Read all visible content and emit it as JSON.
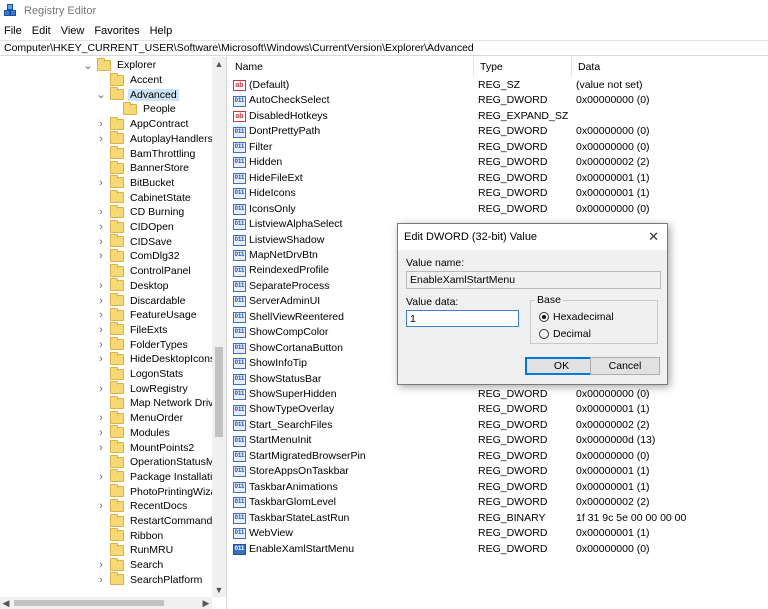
{
  "window": {
    "title": "Registry Editor"
  },
  "menu": [
    "File",
    "Edit",
    "View",
    "Favorites",
    "Help"
  ],
  "address": "Computer\\HKEY_CURRENT_USER\\Software\\Microsoft\\Windows\\CurrentVersion\\Explorer\\Advanced",
  "tree": [
    {
      "label": "Explorer",
      "level": 0,
      "expander": "expanded"
    },
    {
      "label": "Accent",
      "level": 1,
      "expander": "none"
    },
    {
      "label": "Advanced",
      "level": 1,
      "expander": "expanded",
      "selected": true
    },
    {
      "label": "People",
      "level": 2,
      "expander": "none"
    },
    {
      "label": "AppContract",
      "level": 1,
      "expander": "collapsed"
    },
    {
      "label": "AutoplayHandlers",
      "level": 1,
      "expander": "collapsed"
    },
    {
      "label": "BamThrottling",
      "level": 1,
      "expander": "none"
    },
    {
      "label": "BannerStore",
      "level": 1,
      "expander": "none"
    },
    {
      "label": "BitBucket",
      "level": 1,
      "expander": "collapsed"
    },
    {
      "label": "CabinetState",
      "level": 1,
      "expander": "none"
    },
    {
      "label": "CD Burning",
      "level": 1,
      "expander": "collapsed"
    },
    {
      "label": "CIDOpen",
      "level": 1,
      "expander": "collapsed"
    },
    {
      "label": "CIDSave",
      "level": 1,
      "expander": "collapsed"
    },
    {
      "label": "ComDlg32",
      "level": 1,
      "expander": "collapsed"
    },
    {
      "label": "ControlPanel",
      "level": 1,
      "expander": "none"
    },
    {
      "label": "Desktop",
      "level": 1,
      "expander": "collapsed"
    },
    {
      "label": "Discardable",
      "level": 1,
      "expander": "collapsed"
    },
    {
      "label": "FeatureUsage",
      "level": 1,
      "expander": "collapsed"
    },
    {
      "label": "FileExts",
      "level": 1,
      "expander": "collapsed"
    },
    {
      "label": "FolderTypes",
      "level": 1,
      "expander": "collapsed"
    },
    {
      "label": "HideDesktopIcons",
      "level": 1,
      "expander": "collapsed"
    },
    {
      "label": "LogonStats",
      "level": 1,
      "expander": "none"
    },
    {
      "label": "LowRegistry",
      "level": 1,
      "expander": "collapsed"
    },
    {
      "label": "Map Network Drive",
      "level": 1,
      "expander": "none"
    },
    {
      "label": "MenuOrder",
      "level": 1,
      "expander": "collapsed"
    },
    {
      "label": "Modules",
      "level": 1,
      "expander": "collapsed"
    },
    {
      "label": "MountPoints2",
      "level": 1,
      "expander": "collapsed"
    },
    {
      "label": "OperationStatusMar",
      "level": 1,
      "expander": "none"
    },
    {
      "label": "Package Installation",
      "level": 1,
      "expander": "collapsed"
    },
    {
      "label": "PhotoPrintingWizarc",
      "level": 1,
      "expander": "none"
    },
    {
      "label": "RecentDocs",
      "level": 1,
      "expander": "collapsed"
    },
    {
      "label": "RestartCommands",
      "level": 1,
      "expander": "none"
    },
    {
      "label": "Ribbon",
      "level": 1,
      "expander": "none"
    },
    {
      "label": "RunMRU",
      "level": 1,
      "expander": "none"
    },
    {
      "label": "Search",
      "level": 1,
      "expander": "collapsed"
    },
    {
      "label": "SearchPlatform",
      "level": 1,
      "expander": "collapsed"
    }
  ],
  "columns": {
    "name": "Name",
    "type": "Type",
    "data": "Data"
  },
  "values": [
    {
      "name": "(Default)",
      "type": "REG_SZ",
      "data": "(value not set)",
      "icon": "string-value-icon"
    },
    {
      "name": "AutoCheckSelect",
      "type": "REG_DWORD",
      "data": "0x00000000 (0)",
      "icon": "binary-value-icon"
    },
    {
      "name": "DisabledHotkeys",
      "type": "REG_EXPAND_SZ",
      "data": "",
      "icon": "string-value-icon"
    },
    {
      "name": "DontPrettyPath",
      "type": "REG_DWORD",
      "data": "0x00000000 (0)",
      "icon": "binary-value-icon"
    },
    {
      "name": "Filter",
      "type": "REG_DWORD",
      "data": "0x00000000 (0)",
      "icon": "binary-value-icon"
    },
    {
      "name": "Hidden",
      "type": "REG_DWORD",
      "data": "0x00000002 (2)",
      "icon": "binary-value-icon"
    },
    {
      "name": "HideFileExt",
      "type": "REG_DWORD",
      "data": "0x00000001 (1)",
      "icon": "binary-value-icon"
    },
    {
      "name": "HideIcons",
      "type": "REG_DWORD",
      "data": "0x00000001 (1)",
      "icon": "binary-value-icon"
    },
    {
      "name": "IconsOnly",
      "type": "REG_DWORD",
      "data": "0x00000000 (0)",
      "icon": "binary-value-icon"
    },
    {
      "name": "ListviewAlphaSelect",
      "type": "",
      "data": "",
      "icon": "binary-value-icon"
    },
    {
      "name": "ListviewShadow",
      "type": "",
      "data": "",
      "icon": "binary-value-icon"
    },
    {
      "name": "MapNetDrvBtn",
      "type": "",
      "data": "",
      "icon": "binary-value-icon"
    },
    {
      "name": "ReindexedProfile",
      "type": "",
      "data": "",
      "icon": "binary-value-icon"
    },
    {
      "name": "SeparateProcess",
      "type": "",
      "data": "",
      "icon": "binary-value-icon"
    },
    {
      "name": "ServerAdminUI",
      "type": "",
      "data": "",
      "icon": "binary-value-icon"
    },
    {
      "name": "ShellViewReentered",
      "type": "",
      "data": "",
      "icon": "binary-value-icon"
    },
    {
      "name": "ShowCompColor",
      "type": "",
      "data": "",
      "icon": "binary-value-icon"
    },
    {
      "name": "ShowCortanaButton",
      "type": "",
      "data": "",
      "icon": "binary-value-icon"
    },
    {
      "name": "ShowInfoTip",
      "type": "",
      "data": "",
      "icon": "binary-value-icon"
    },
    {
      "name": "ShowStatusBar",
      "type": "",
      "data": "",
      "icon": "binary-value-icon"
    },
    {
      "name": "ShowSuperHidden",
      "type": "REG_DWORD",
      "data": "0x00000000 (0)",
      "icon": "binary-value-icon"
    },
    {
      "name": "ShowTypeOverlay",
      "type": "REG_DWORD",
      "data": "0x00000001 (1)",
      "icon": "binary-value-icon"
    },
    {
      "name": "Start_SearchFiles",
      "type": "REG_DWORD",
      "data": "0x00000002 (2)",
      "icon": "binary-value-icon"
    },
    {
      "name": "StartMenuInit",
      "type": "REG_DWORD",
      "data": "0x0000000d (13)",
      "icon": "binary-value-icon"
    },
    {
      "name": "StartMigratedBrowserPin",
      "type": "REG_DWORD",
      "data": "0x00000000 (0)",
      "icon": "binary-value-icon"
    },
    {
      "name": "StoreAppsOnTaskbar",
      "type": "REG_DWORD",
      "data": "0x00000001 (1)",
      "icon": "binary-value-icon"
    },
    {
      "name": "TaskbarAnimations",
      "type": "REG_DWORD",
      "data": "0x00000001 (1)",
      "icon": "binary-value-icon"
    },
    {
      "name": "TaskbarGlomLevel",
      "type": "REG_DWORD",
      "data": "0x00000002 (2)",
      "icon": "binary-value-icon"
    },
    {
      "name": "TaskbarStateLastRun",
      "type": "REG_BINARY",
      "data": "1f 31 9c 5e 00 00 00 00",
      "icon": "binary-value-icon"
    },
    {
      "name": "WebView",
      "type": "REG_DWORD",
      "data": "0x00000001 (1)",
      "icon": "binary-value-icon"
    },
    {
      "name": "EnableXamlStartMenu",
      "type": "REG_DWORD",
      "data": "0x00000000 (0)",
      "icon": "binary-value-icon",
      "highlight": true
    }
  ],
  "dialog": {
    "title": "Edit DWORD (32-bit) Value",
    "value_name_label": "Value name:",
    "value_name": "EnableXamlStartMenu",
    "value_data_label": "Value data:",
    "value_data": "1",
    "base_label": "Base",
    "base_options": [
      "Hexadecimal",
      "Decimal"
    ],
    "base_selected": "Hexadecimal",
    "ok_label": "OK",
    "cancel_label": "Cancel"
  },
  "colors": {
    "selection": "#cce4f7",
    "accent": "#0078d7",
    "folder": "#f8d775"
  }
}
